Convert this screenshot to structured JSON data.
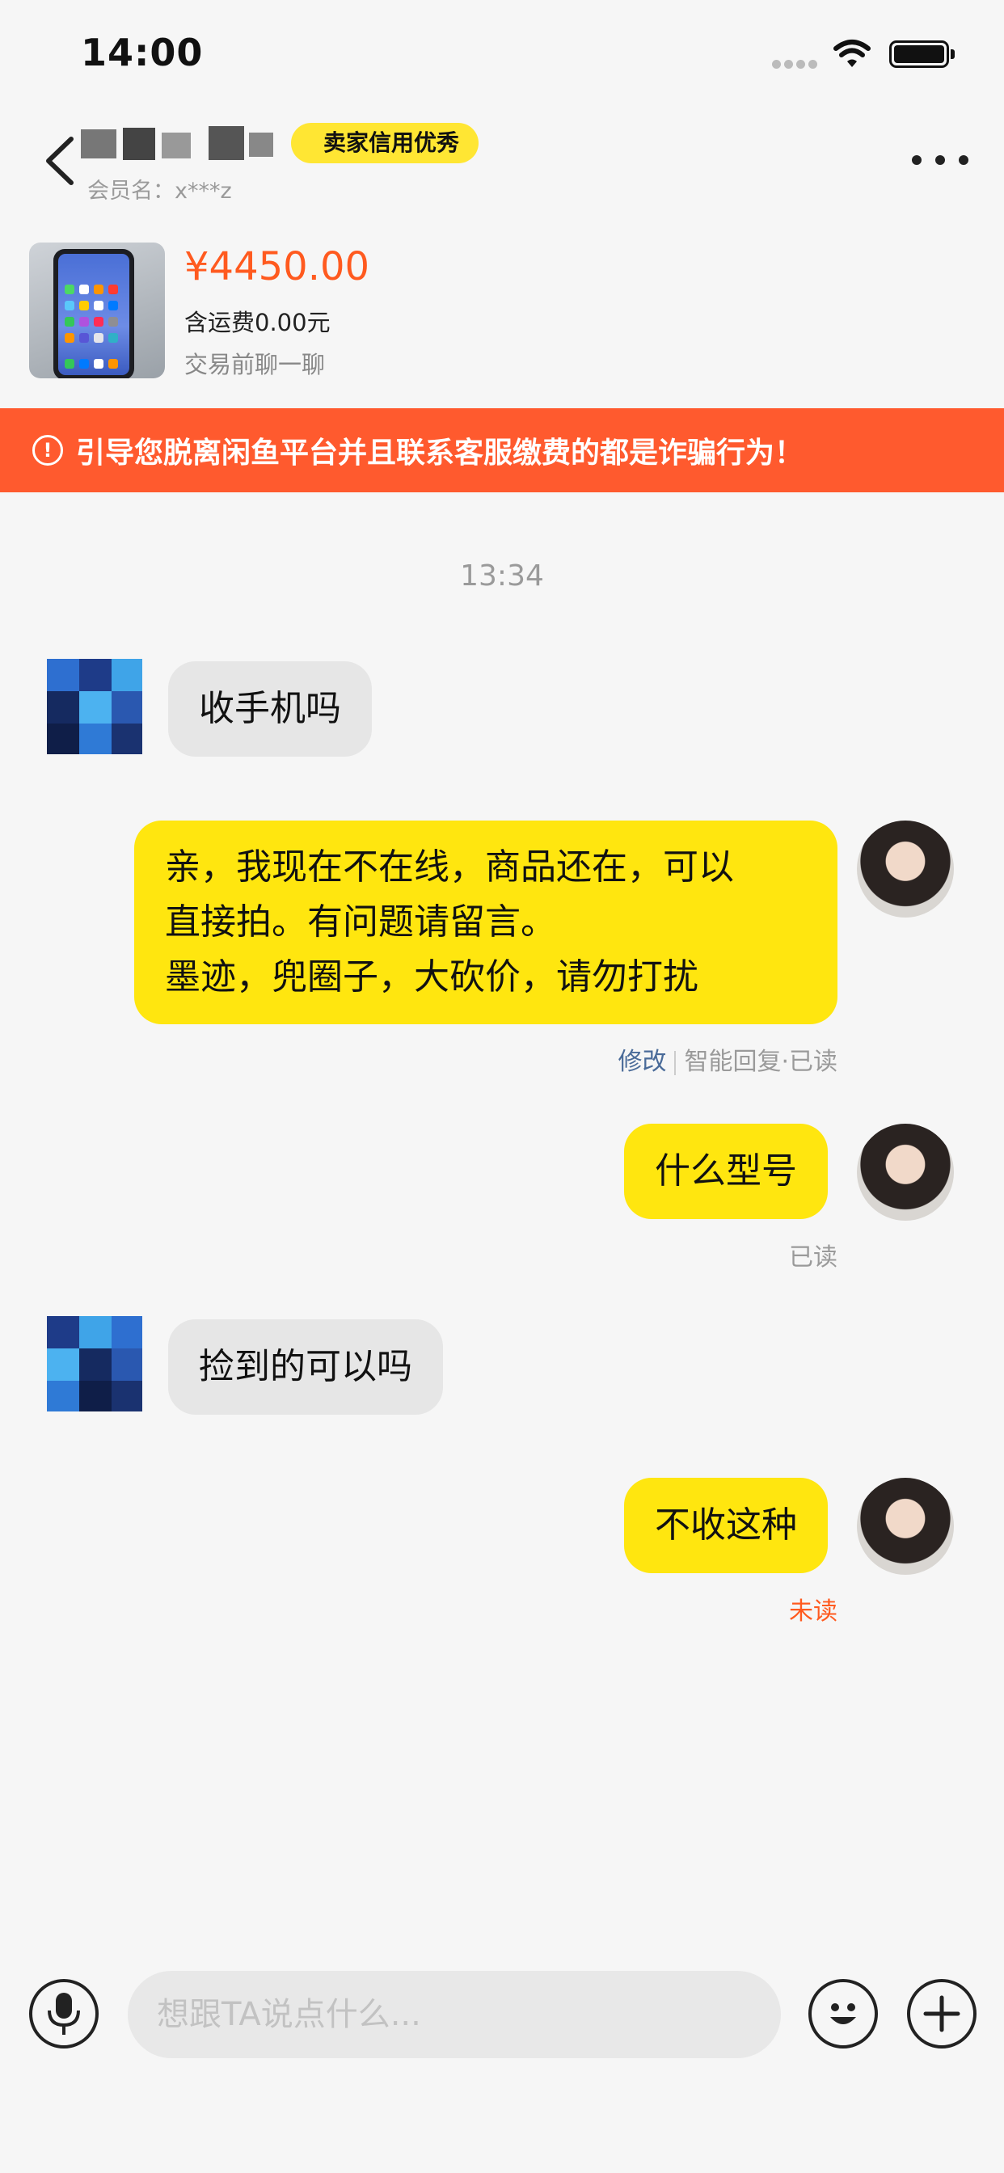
{
  "status_bar": {
    "time": "14:00"
  },
  "header": {
    "seller_badge": "卖家信用优秀",
    "member_label": "会员名：x***z"
  },
  "product": {
    "price": "¥4450.00",
    "shipping": "含运费0.00元",
    "chat_prompt": "交易前聊一聊"
  },
  "warning": {
    "text": "引导您脱离闲鱼平台并且联系客服缴费的都是诈骗行为！"
  },
  "chat": {
    "timestamp": "13:34",
    "messages": [
      {
        "side": "left",
        "text": "收手机吗"
      },
      {
        "side": "right",
        "lines": [
          "亲，我现在不在线，商品还在，可以",
          "直接拍。有问题请留言。",
          "墨迹，兜圈子，大砍价，请勿打扰"
        ],
        "edit_label": "修改",
        "status": "智能回复·已读"
      },
      {
        "side": "right",
        "text": "什么型号",
        "status": "已读"
      },
      {
        "side": "left",
        "text": "捡到的可以吗"
      },
      {
        "side": "right",
        "text": "不收这种",
        "status": "未读"
      }
    ]
  },
  "input": {
    "placeholder": "想跟TA说点什么..."
  },
  "icons": {
    "back": "chevron-left-icon",
    "more": "more-dots-icon",
    "voice": "microphone-icon",
    "emoji": "emoji-icon",
    "add": "plus-icon",
    "warning": "exclamation-circle-icon"
  },
  "colors": {
    "accent_orange": "#ff5a1f",
    "bubble_yellow": "#ffe60f",
    "badge_yellow": "#ffe633",
    "banner": "#ff5a2e"
  }
}
